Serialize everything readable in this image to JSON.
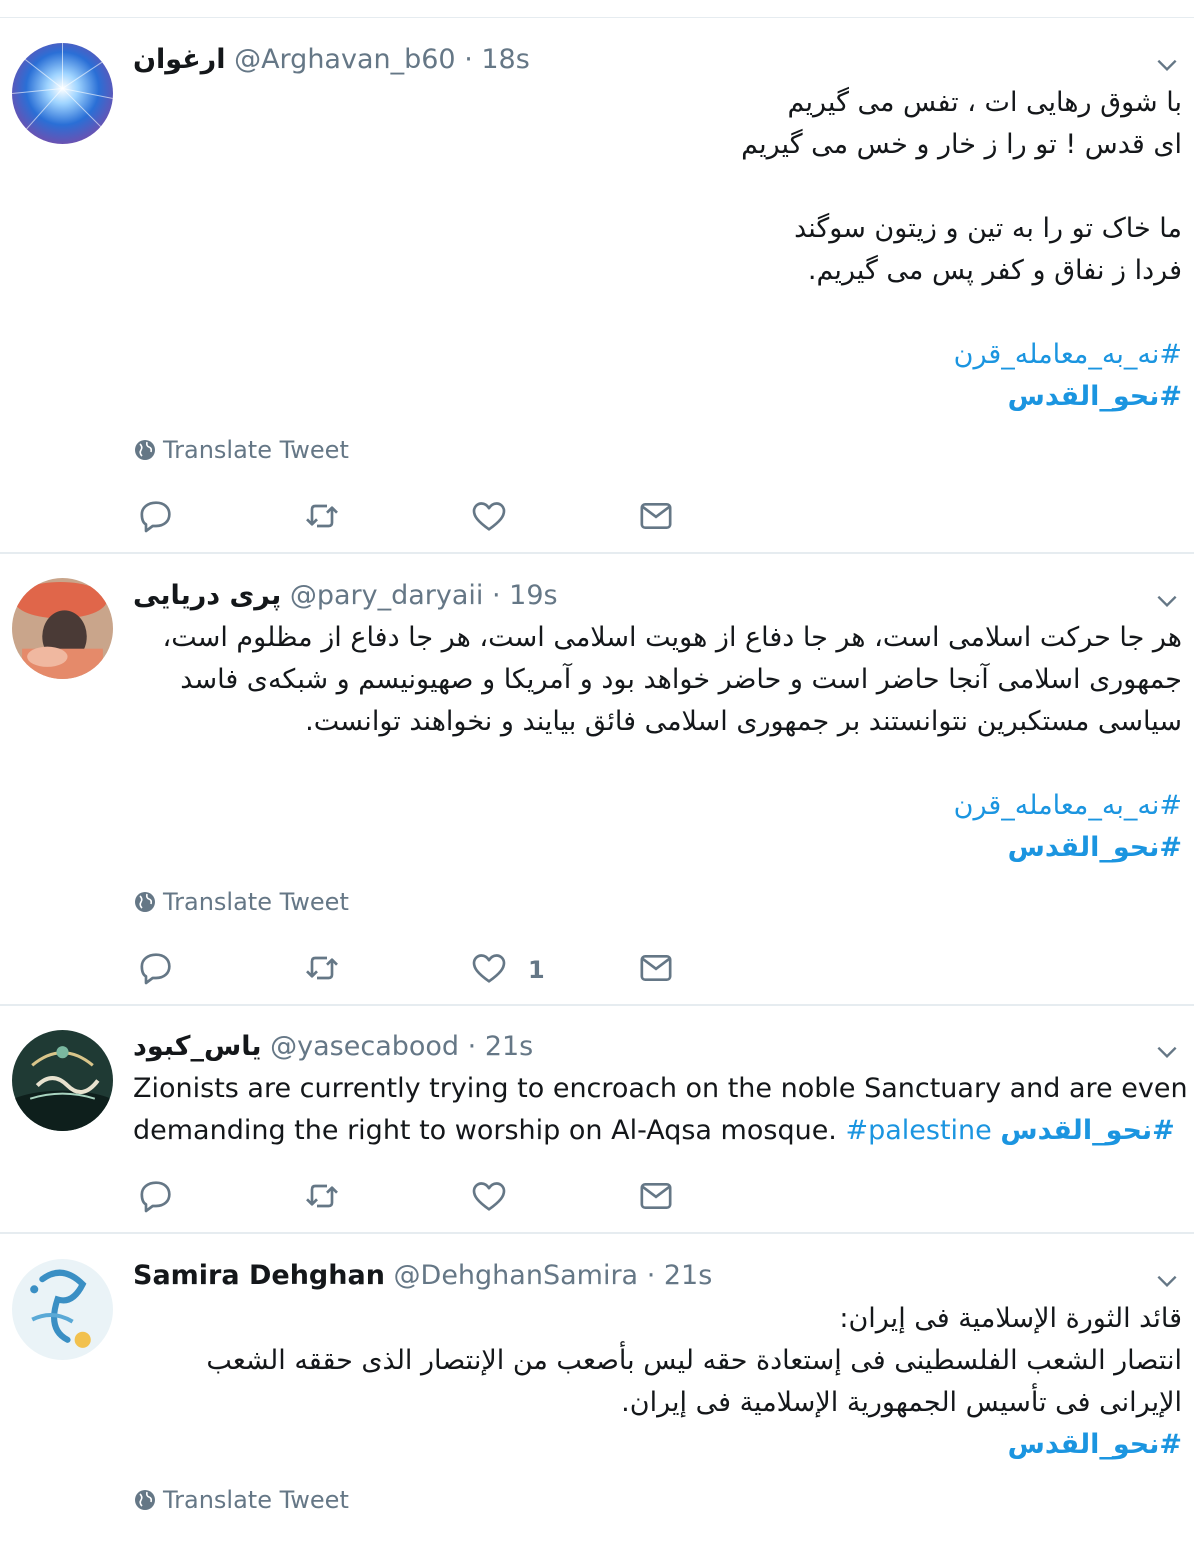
{
  "translate_label": "Translate Tweet",
  "colors": {
    "hashtag": "#1b95e0",
    "meta": "#657786",
    "divider": "#e6ecf0"
  },
  "tweets": [
    {
      "name": "ارغوان",
      "handle": "@Arghavan_b60",
      "time": "· 18s",
      "lines": [
        "با شوق رهایی ات ، تفس می گیریم",
        "ای قدس ! تو را ز خار و خس می گیریم",
        "",
        "ما خاک تو را به تین و زیتون سوگند",
        "فردا ز نفاق و کفر پس می گیریم.",
        ""
      ],
      "hashtags": [
        "#نه_به_معامله_قرن",
        "#نحو_القدس"
      ],
      "like_count": ""
    },
    {
      "name": "پری دریایی",
      "handle": "@pary_daryaii",
      "time": "· 19s",
      "lines": [
        "هر جا حرکت اسلامی است، هر جا دفاع از هویت اسلامی است، هر جا دفاع از مظلوم است،",
        "جمهوری اسلامی آنجا حاضر است و حاضر خواهد بود و آمریکا و صهیونیسم و شبکه‌ی فاسد",
        "سیاسی مستکبرین نتوانستند بر جمهوری اسلامی فائق بیایند و نخواهند توانست.",
        ""
      ],
      "hashtags": [
        "#نه_به_معامله_قرن",
        "#نحو_القدس"
      ],
      "like_count": "1"
    },
    {
      "name": "یاس_کبود",
      "handle": "@yasecabood",
      "time": "· 21s",
      "line1": "Zionists are currently trying to encroach on the noble Sanctuary and are even",
      "line2": "demanding the right to worship on Al-Aqsa mosque.",
      "hashtags": [
        "#palestine",
        "#نحو_القدس"
      ],
      "like_count": ""
    },
    {
      "name": "Samira Dehghan",
      "handle": "@DehghanSamira",
      "time": "· 21s",
      "lines": [
        "قائد الثورة الإسلامية فی إیران:",
        "انتصار الشعب الفلسطینی فی إستعادة حقه لیس بأصعب من الإنتصار الذی حققه الشعب",
        "الإیرانی فی تأسیس الجمهوریة الإسلامیة فی إیران."
      ],
      "hashtags": [
        "#نحو_القدس"
      ],
      "like_count": ""
    }
  ]
}
